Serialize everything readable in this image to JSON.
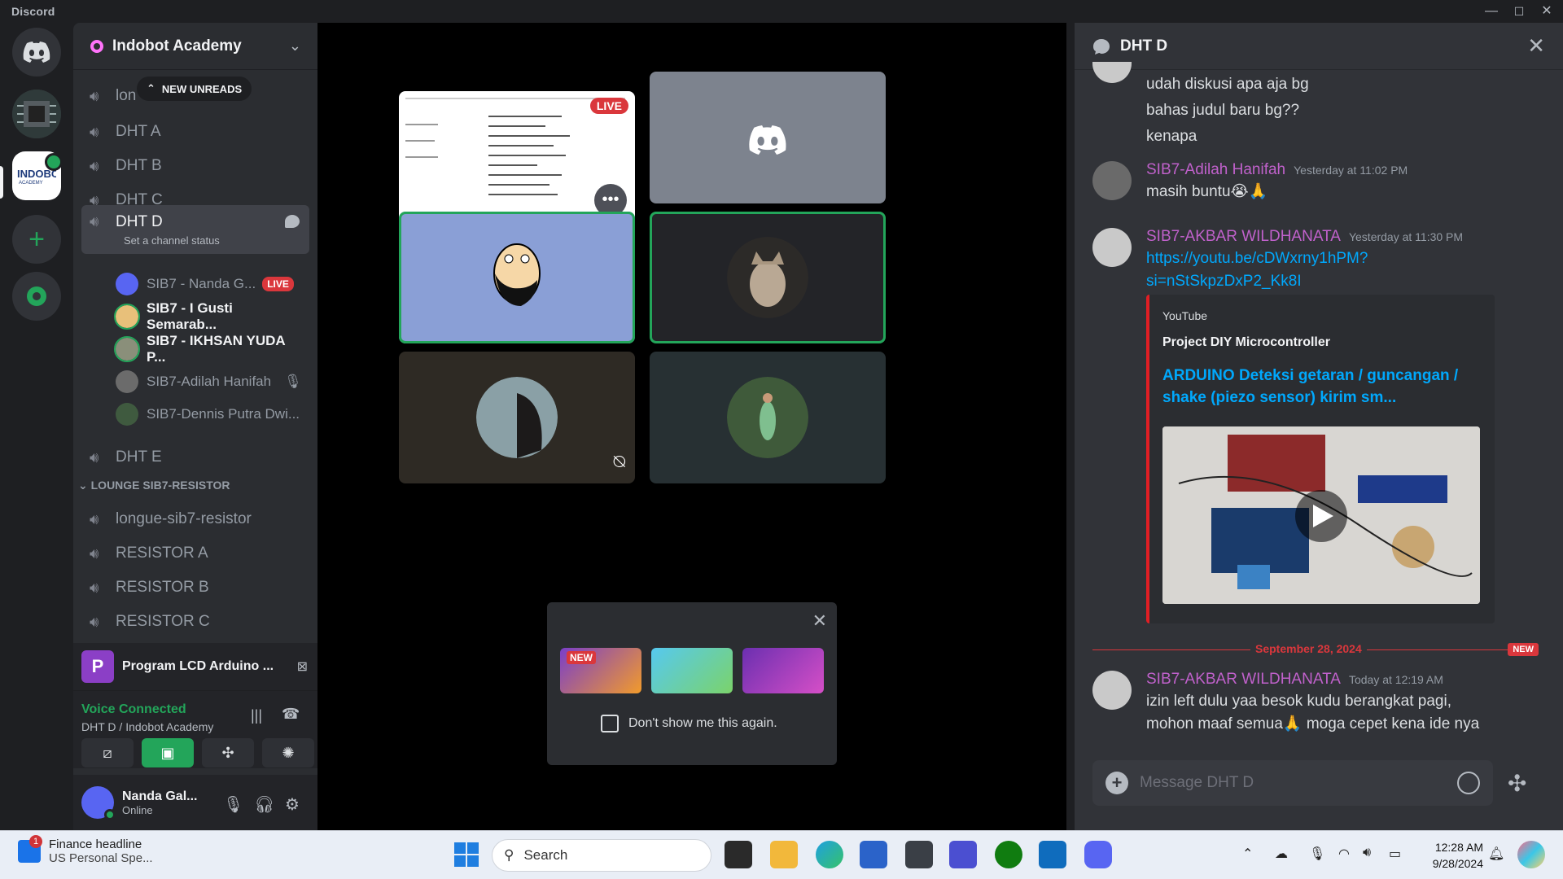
{
  "window": {
    "app_name": "Discord",
    "minimize": "—",
    "maximize": "☐",
    "close": "✕"
  },
  "server": {
    "name": "Indobot Academy"
  },
  "sidebar": {
    "new_unreads": "NEW UNREADS",
    "channels_top": [
      "lon",
      "DHT A",
      "DHT B",
      "DHT C"
    ],
    "active_channel": {
      "name": "DHT D",
      "status": "Set a channel status"
    },
    "voice_users": [
      {
        "name": "SIB7 - Nanda G...",
        "live": "LIVE"
      },
      {
        "name": "SIB7 - I Gusti Semarab..."
      },
      {
        "name": "SIB7 - IKHSAN YUDA P..."
      },
      {
        "name": "SIB7-Adilah Hanifah"
      },
      {
        "name": "SIB7-Dennis Putra Dwi..."
      }
    ],
    "channel_after": "DHT E",
    "category": "LOUNGE SIB7-RESISTOR",
    "category_channels": [
      "longue-sib7-resistor",
      "RESISTOR A",
      "RESISTOR B",
      "RESISTOR C"
    ],
    "activity": {
      "icon_letter": "P",
      "title": "Program LCD Arduino ..."
    },
    "voice": {
      "status": "Voice Connected",
      "location": "DHT D / Indobot Academy"
    },
    "user": {
      "name": "Nanda Gal...",
      "status": "Online"
    }
  },
  "stage": {
    "live_label": "LIVE",
    "more": "•••",
    "promo": {
      "new_label": "NEW",
      "checkbox_label": "Don't show me this again."
    }
  },
  "chat": {
    "title": "DHT D",
    "messages_top": [
      "udah diskusi apa aja bg",
      "bahas judul baru bg??",
      "kenapa"
    ],
    "msg1": {
      "author": "SIB7-Adilah Hanifah",
      "time": "Yesterday at 11:02 PM",
      "text": "masih buntu😭🙏"
    },
    "msg2": {
      "author": "SIB7-AKBAR WILDHANATA",
      "time": "Yesterday at 11:30 PM",
      "link_line1": "https://youtu.be/cDWxrny1hPM?",
      "link_line2": "si=nStSkpzDxP2_Kk8I",
      "embed": {
        "provider": "YouTube",
        "author": "Project DIY Microcontroller",
        "title": "ARDUINO Deteksi getaran / guncangan / shake (piezo sensor) kirim sm..."
      }
    },
    "divider": {
      "date": "September 28, 2024",
      "new": "NEW"
    },
    "msg3": {
      "author": "SIB7-AKBAR WILDHANATA",
      "time": "Today at 12:19 AM",
      "line1": "izin left dulu yaa besok kudu berangkat pagi,",
      "line2": "mohon maaf semua🙏 moga cepet kena ide nya"
    },
    "composer_placeholder": "Message DHT D"
  },
  "taskbar": {
    "news_badge": "1",
    "news_title": "Finance headline",
    "news_sub": "US Personal Spe...",
    "search": "Search",
    "time": "12:28 AM",
    "date": "9/28/2024"
  },
  "colors": {
    "accent_green": "#23a55a",
    "live_red": "#da373c",
    "link_blue": "#00a8fc",
    "author_purple": "#c061cb"
  }
}
